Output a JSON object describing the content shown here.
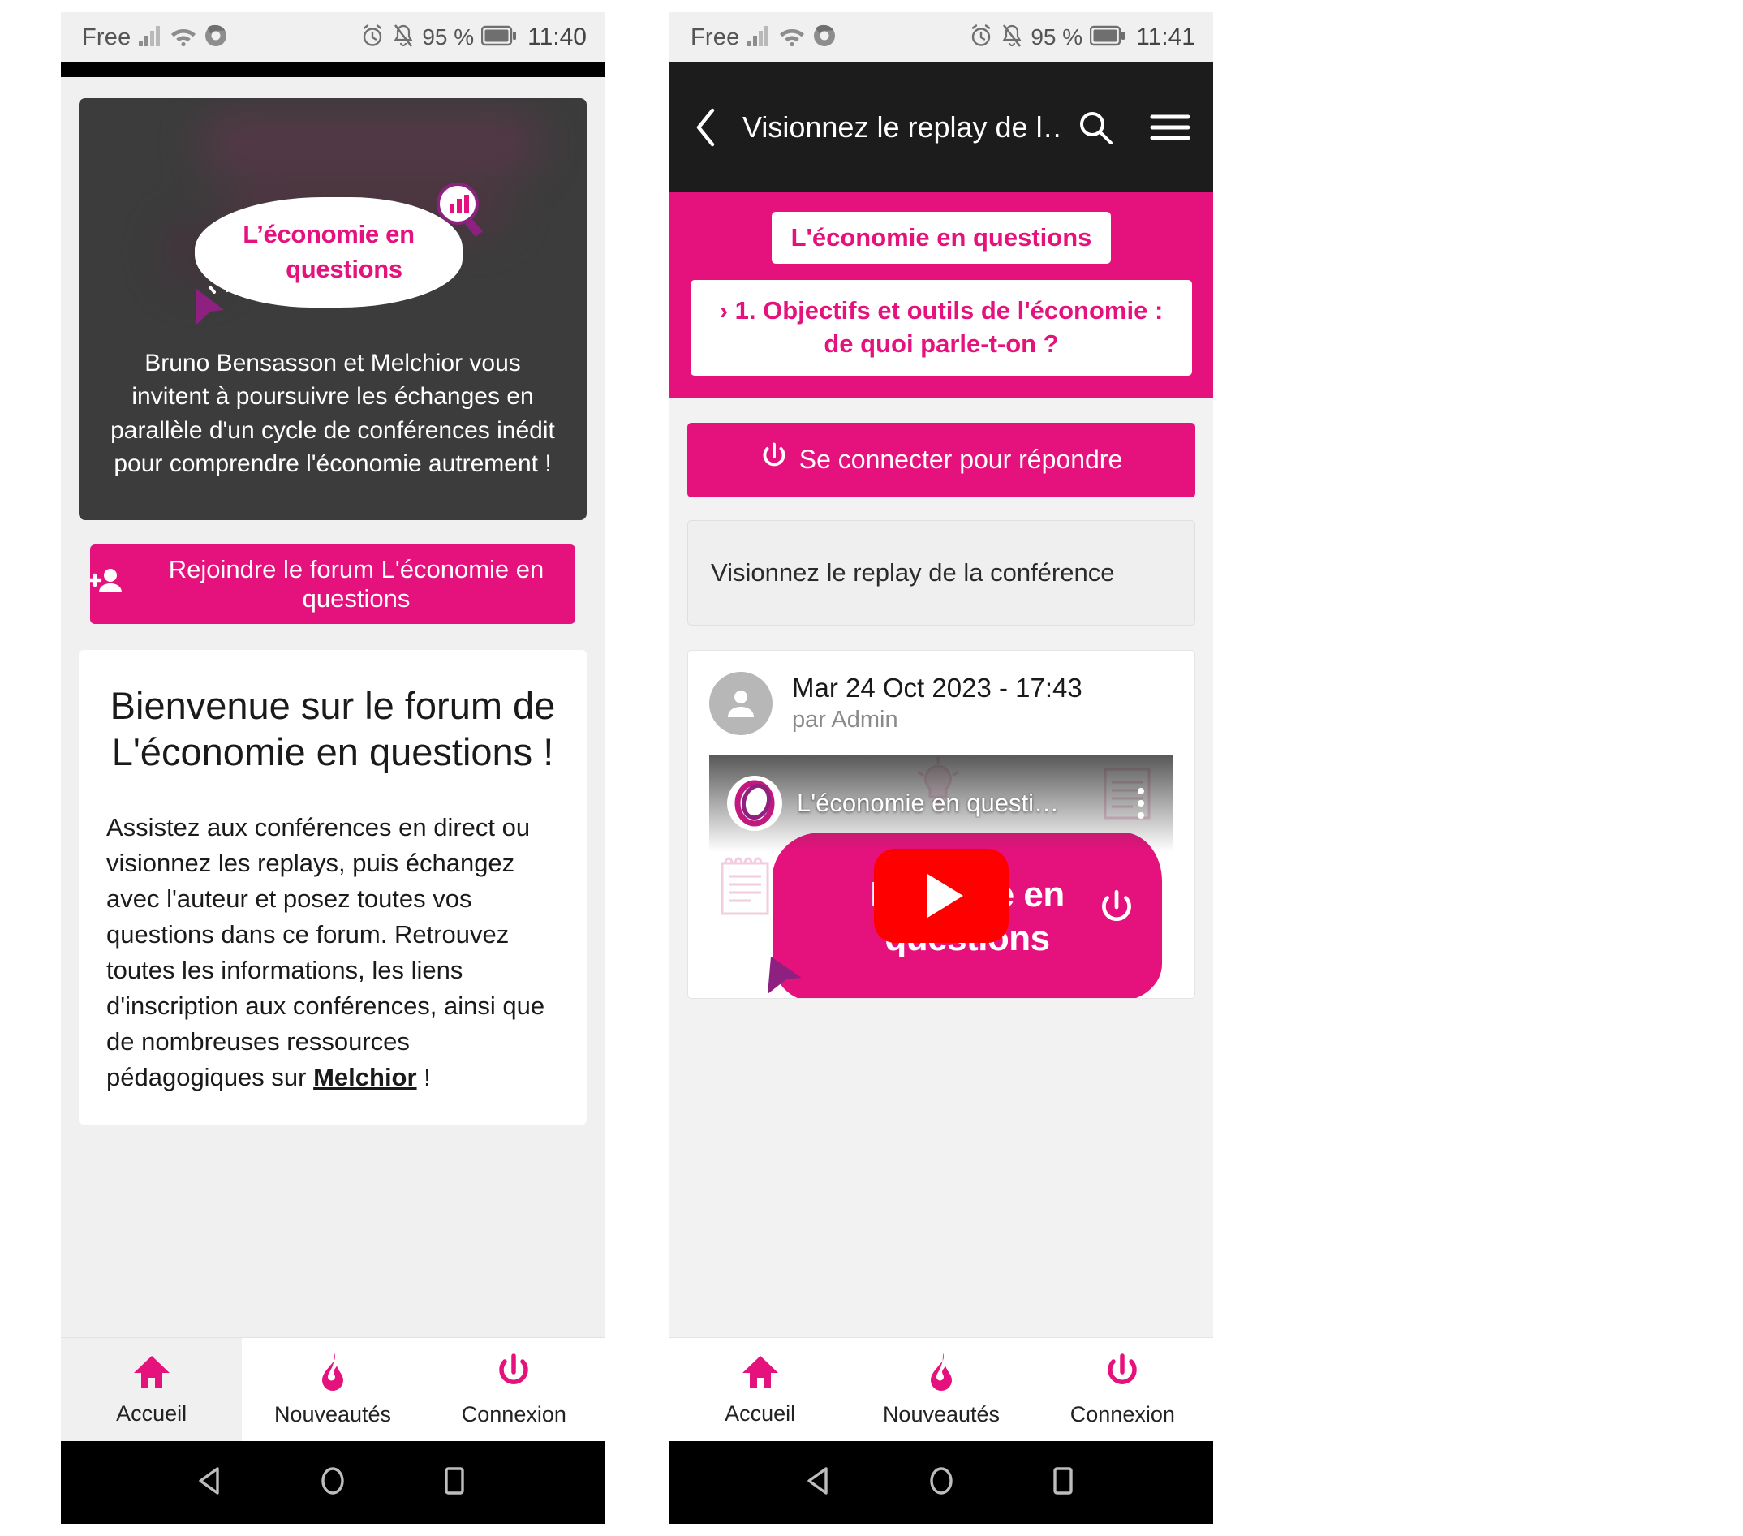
{
  "left_phone": {
    "statusbar": {
      "carrier": "Free",
      "battery_percent": "95 %",
      "time": "11:40",
      "icons": [
        "signal-icon",
        "wifi-icon",
        "chrome-icon",
        "alarm-icon",
        "bell-muted-icon",
        "battery-icon"
      ]
    },
    "hero": {
      "logo_line1": "L’économie en",
      "logo_line2": "questions",
      "paragraph": "Bruno Bensasson et Melchior vous invitent à poursuivre les échanges en parallèle d'un cycle de conférences inédit pour comprendre l'économie autrement !"
    },
    "join_button": {
      "label": "Rejoindre le forum L'économie en questions",
      "icon": "person-add-icon"
    },
    "welcome": {
      "title": "Bienvenue sur le forum de L'économie en questions !",
      "body_before": "Assistez aux conférences en direct ou visionnez les replays, puis échangez avec l'auteur et posez toutes vos questions dans ce forum. Retrouvez toutes les informations, les liens d'inscription aux conférences, ainsi que de nombreuses ressources pédagogiques sur ",
      "body_link": "Melchior",
      "body_after": " !"
    },
    "tabs": [
      {
        "label": "Accueil",
        "icon": "home-icon",
        "active": true
      },
      {
        "label": "Nouveautés",
        "icon": "flame-icon",
        "active": false
      },
      {
        "label": "Connexion",
        "icon": "power-icon",
        "active": false
      }
    ],
    "navbar": [
      "back-triangle-icon",
      "home-circle-icon",
      "recents-square-icon"
    ]
  },
  "right_phone": {
    "statusbar": {
      "carrier": "Free",
      "battery_percent": "95 %",
      "time": "11:41",
      "icons": [
        "signal-icon",
        "wifi-icon",
        "chrome-icon",
        "alarm-icon",
        "bell-muted-icon",
        "battery-icon"
      ]
    },
    "appbar": {
      "back_icon": "chevron-left-icon",
      "title": "Visionnez le replay de l…",
      "search_icon": "search-icon",
      "menu_icon": "hamburger-menu-icon"
    },
    "breadcrumb": {
      "forum": "L'économie en questions",
      "category": "› 1. Objectifs et outils de l'économie : de quoi parle-t-on ?"
    },
    "login_button": {
      "label": "Se connecter pour répondre",
      "icon": "power-icon"
    },
    "topic_title": "Visionnez le replay de la conférence",
    "post": {
      "avatar": "user-avatar-icon",
      "date": "Mar 24 Oct 2023 - 17:43",
      "author": "par Admin"
    },
    "video": {
      "channel_avatar": "youtube-channel-avatar-icon",
      "title": "L'économie en questi…",
      "kebab": "more-options-icon",
      "play_button": "youtube-play-icon",
      "thumb_line1": "L’éco…e en",
      "thumb_line2": "questions"
    },
    "tabs": [
      {
        "label": "Accueil",
        "icon": "home-icon",
        "active": false
      },
      {
        "label": "Nouveautés",
        "icon": "flame-icon",
        "active": false
      },
      {
        "label": "Connexion",
        "icon": "power-icon",
        "active": false
      }
    ],
    "navbar": [
      "back-triangle-icon",
      "home-circle-icon",
      "recents-square-icon"
    ]
  },
  "colors": {
    "brand_pink": "#e5127d",
    "dark_card": "#3c3c3c",
    "appbar_dark": "#1c1c1c",
    "page_bg": "#f0f0f0",
    "youtube_red": "#ff0000",
    "magenta_purple": "#8e2080"
  }
}
